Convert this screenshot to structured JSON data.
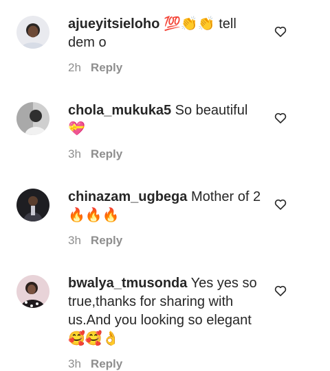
{
  "comments": [
    {
      "username": "ajueyitsieloho",
      "text": "💯👏👏 tell dem o",
      "time": "2h",
      "reply": "Reply",
      "avatar_icon": "user-avatar"
    },
    {
      "username": "chola_mukuka5",
      "text": "So beautiful 💝",
      "time": "3h",
      "reply": "Reply",
      "avatar_icon": "user-avatar"
    },
    {
      "username": "chinazam_ugbega",
      "text": "Mother of 2 🔥🔥🔥",
      "time": "3h",
      "reply": "Reply",
      "avatar_icon": "user-avatar"
    },
    {
      "username": "bwalya_tmusonda",
      "text": "Yes yes so true,thanks for sharing with us.And you looking so elegant 🥰🥰👌",
      "time": "3h",
      "reply": "Reply",
      "avatar_icon": "user-avatar"
    }
  ],
  "icons": {
    "like": "heart-outline-icon"
  },
  "colors": {
    "text": "#262626",
    "secondary": "#8e8e8e",
    "background": "#ffffff"
  }
}
